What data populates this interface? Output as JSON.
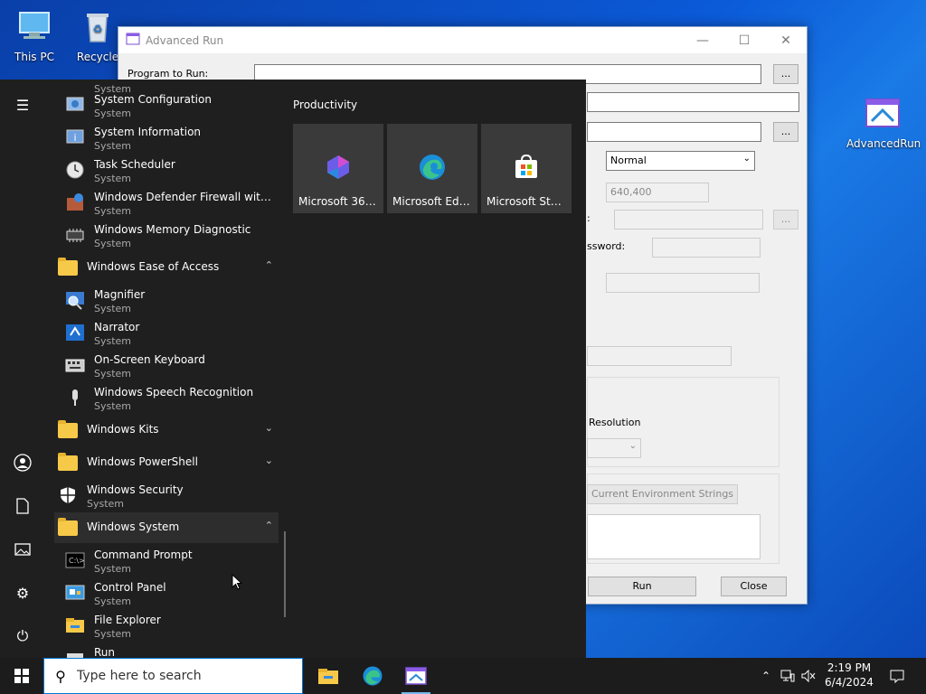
{
  "desktop": {
    "icons": [
      {
        "label": "This PC"
      },
      {
        "label": "Recycle"
      },
      {
        "label": "AdvancedRun"
      }
    ]
  },
  "window": {
    "title": "Advanced Run",
    "program_label": "Program to Run:",
    "browse_label": "...",
    "window_state": "Normal",
    "position_value": "640,400",
    "password_label_fragment": "ssword:",
    "colon_fragment": ":",
    "resolution_label_fragment": "Resolution",
    "env_button_fragment": "Current Environment Strings",
    "run_label": "Run",
    "close_label": "Close"
  },
  "start_menu": {
    "apps_top": [
      {
        "name": "System",
        "sub": ""
      },
      {
        "name": "System Configuration",
        "sub": "System"
      },
      {
        "name": "System Information",
        "sub": "System"
      },
      {
        "name": "Task Scheduler",
        "sub": "System"
      },
      {
        "name": "Windows Defender Firewall with Ad...",
        "sub": "System"
      },
      {
        "name": "Windows Memory Diagnostic",
        "sub": "System"
      }
    ],
    "group_ease": "Windows Ease of Access",
    "apps_ease": [
      {
        "name": "Magnifier",
        "sub": "System"
      },
      {
        "name": "Narrator",
        "sub": "System"
      },
      {
        "name": "On-Screen Keyboard",
        "sub": "System"
      },
      {
        "name": "Windows Speech Recognition",
        "sub": "System"
      }
    ],
    "group_kits": "Windows Kits",
    "group_powershell": "Windows PowerShell",
    "security": {
      "name": "Windows Security",
      "sub": "System"
    },
    "group_system": "Windows System",
    "apps_system": [
      {
        "name": "Command Prompt",
        "sub": "System"
      },
      {
        "name": "Control Panel",
        "sub": "System"
      },
      {
        "name": "File Explorer",
        "sub": "System"
      },
      {
        "name": "Run",
        "sub": ""
      }
    ],
    "tiles_header": "Productivity",
    "tiles": [
      {
        "label": "Microsoft 365..."
      },
      {
        "label": "Microsoft Edge"
      },
      {
        "label": "Microsoft Store"
      }
    ]
  },
  "taskbar": {
    "search_placeholder": "Type here to search",
    "time": "2:19 PM",
    "date": "6/4/2024"
  }
}
